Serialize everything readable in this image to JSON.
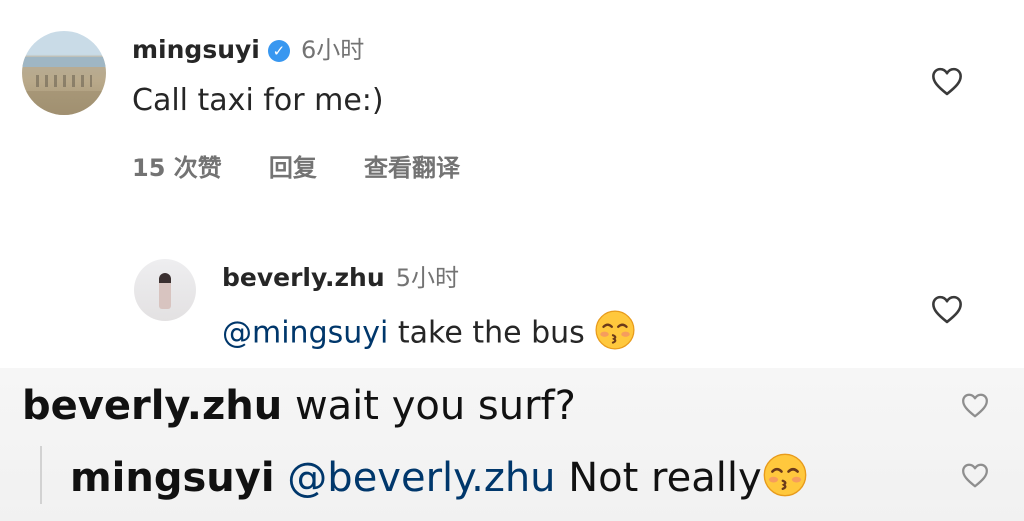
{
  "comments": [
    {
      "username": "mingsuyi",
      "verified": true,
      "time": "6小时",
      "text": "Call taxi for me:)",
      "likes": "15 次赞",
      "reply": "回复",
      "translate": "查看翻译"
    },
    {
      "username": "beverly.zhu",
      "time": "5小时",
      "mention": "@mingsuyi",
      "text": " take the bus",
      "emoji": "kissing-face-with-closed-eyes"
    }
  ],
  "overlay": {
    "line1": {
      "username": "beverly.zhu",
      "text": " wait you surf?"
    },
    "line2": {
      "username": "mingsuyi",
      "mention": "@beverly.zhu",
      "text": " Not really",
      "emoji": "kissing-face-with-closed-eyes"
    }
  },
  "colors": {
    "mention": "#00376b",
    "muted": "#737373",
    "verified": "#3897f0"
  }
}
